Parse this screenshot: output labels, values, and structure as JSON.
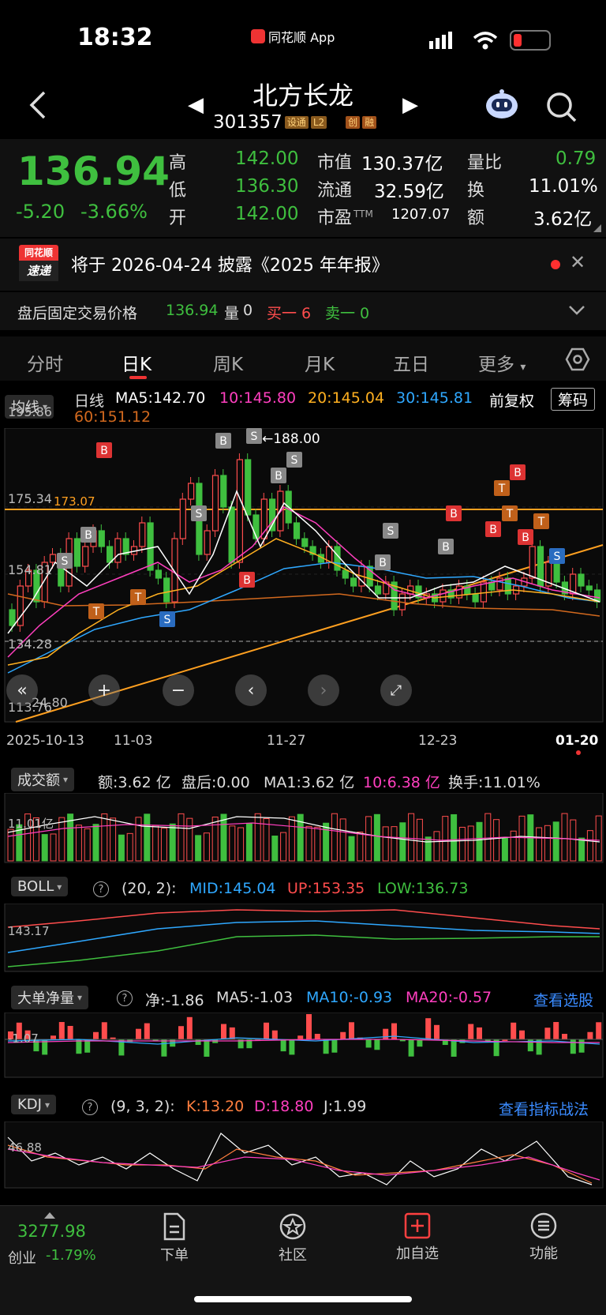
{
  "status": {
    "time": "18:32",
    "app": "同花顺 App"
  },
  "header": {
    "title": "北方长龙",
    "code": "301357",
    "badges": [
      "设通",
      "L2",
      "创",
      "融"
    ]
  },
  "quote": {
    "price": "136.94",
    "change": "-5.20",
    "change_pct": "-3.66%",
    "high_label": "高",
    "high": "142.00",
    "low_label": "低",
    "low": "136.30",
    "open_label": "开",
    "open": "142.00",
    "mcap_label": "市值",
    "mcap": "130.37亿",
    "float_label": "流通",
    "float": "32.59亿",
    "pe_label": "市盈",
    "pe_sup": "TTM",
    "pe": "1207.07",
    "vr_label": "量比",
    "vr": "0.79",
    "turn_label": "换",
    "turn": "11.01%",
    "amt_label": "额",
    "amt": "3.62亿"
  },
  "notice": {
    "logo_top": "同花顺",
    "logo_bottom": "速递",
    "text": "将于 2026-04-24 披露《2025 年年报》"
  },
  "afterhours": {
    "label": "盘后固定交易价格",
    "price": "136.94",
    "vol_label": "量",
    "vol": "0",
    "buy": "买一 6",
    "sell": "卖一 0"
  },
  "tabs": [
    "分时",
    "日K",
    "周K",
    "月K",
    "五日",
    "更多"
  ],
  "active_tab": 1,
  "ma_legend": {
    "select": "均线",
    "period": "日线",
    "ma5": "MA5:142.70",
    "ma10": "10:145.80",
    "ma20": "20:145.04",
    "ma30": "30:145.81",
    "ma60": "60:151.12",
    "adjust": "前复权",
    "chips": "筹码"
  },
  "kline": {
    "y_labels": [
      "195.86",
      "175.34",
      "154.81",
      "134.28",
      "113.76"
    ],
    "line_value": "173.07",
    "peak": "←188.00",
    "low_mark": "24.80",
    "dates": [
      "2025-10-13",
      "11-03",
      "11-27",
      "12-23",
      "01-20"
    ]
  },
  "volume": {
    "select": "成交额",
    "amt": "额:3.62 亿",
    "after": "盘后:0.00",
    "ma1": "MA1:3.62 亿",
    "ma10": "10:6.38 亿",
    "turn": "换手:11.01%",
    "axis": "11.01亿"
  },
  "boll": {
    "select": "BOLL",
    "params": "(20, 2):",
    "mid": "MID:145.04",
    "up": "UP:153.35",
    "low": "LOW:136.73",
    "axis": "143.17"
  },
  "bigorder": {
    "select": "大单净量",
    "net": "净:-1.86",
    "ma5": "MA5:-1.03",
    "ma10": "MA10:-0.93",
    "ma20": "MA20:-0.57",
    "link": "查看选股",
    "axis": "-1.07"
  },
  "kdj": {
    "select": "KDJ",
    "params": "(9, 3, 2):",
    "k": "K:13.20",
    "d": "D:18.80",
    "j": "J:1.99",
    "link": "查看指标战法",
    "axis": "46.88"
  },
  "bottom": {
    "index_value": "3277.98",
    "index_name": "创业",
    "index_change": "-1.79%",
    "items": [
      "下单",
      "社区",
      "加自选",
      "功能"
    ]
  },
  "colors": {
    "up": "#ff4d4d",
    "down": "#3fbf3f",
    "ma5": "#ffffff",
    "ma10": "#ff3fbf",
    "ma20": "#ffb020",
    "ma30": "#2fa8ff",
    "ma60": "#d2691e"
  }
}
